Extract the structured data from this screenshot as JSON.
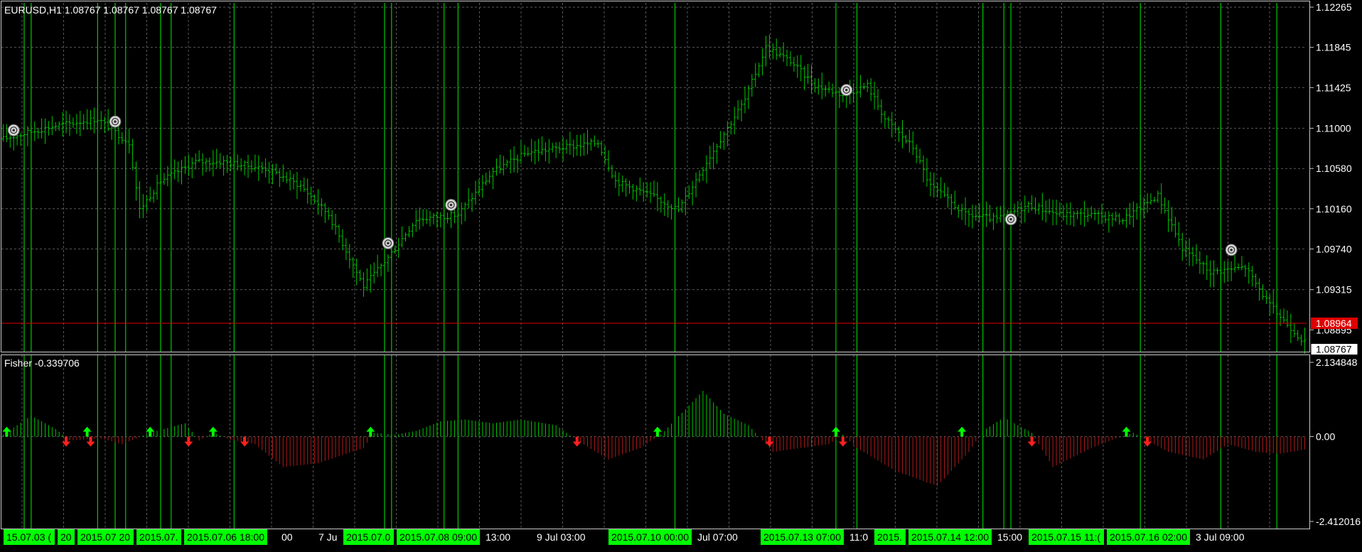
{
  "header": {
    "symbol_line": "EURUSD,H1  1.08767 1.08767 1.08767 1.08767",
    "indicator_line": "Fisher -0.339706"
  },
  "colors": {
    "background": "#000000",
    "frame": "#c8c8c8",
    "grid": "#5a5a5a",
    "bar": "#00c800",
    "signal_line": "#00c800",
    "hist_pos": "#00c800",
    "hist_neg": "#b41a1a",
    "arrow_up": "#00ff00",
    "arrow_down": "#ff2020",
    "red_line": "#e00000",
    "label_text": "#ffffff",
    "time_tag_bg": "#00ff00",
    "time_tag_text": "#000000"
  },
  "price_axis": {
    "ticks": [
      "1.12265",
      "1.11845",
      "1.11425",
      "1.11000",
      "1.10580",
      "1.10160",
      "1.09740",
      "1.09315"
    ],
    "label_partial": "1.08895",
    "red_level_label": "1.08964",
    "current_price_label": "1.08767"
  },
  "indicator_axis": {
    "ticks": [
      "2.134848",
      "0.00",
      "-2.412016"
    ]
  },
  "time_axis": {
    "labels": [
      {
        "text": "15.07.03 (",
        "tag": true
      },
      {
        "text": "20",
        "tag": true
      },
      {
        "text": "2015.07 20",
        "tag": true
      },
      {
        "text": "2015.07.",
        "tag": true
      },
      {
        "text": "2015.07.06 18:00",
        "tag": true
      },
      {
        "text": "00",
        "tag": false
      },
      {
        "text": "7 Ju",
        "tag": false
      },
      {
        "text": "2015.07.0",
        "tag": true
      },
      {
        "text": "2015.07.08 09:00",
        "tag": true
      },
      {
        "text": "13:00",
        "tag": false
      },
      {
        "text": "9 Jul 03:00",
        "tag": false
      },
      {
        "text": "2015.07.10 00:00",
        "tag": true
      },
      {
        "text": "Jul 07:00",
        "tag": false
      },
      {
        "text": "2015.07.13 07:00",
        "tag": true
      },
      {
        "text": "11:0",
        "tag": false
      },
      {
        "text": "2015.",
        "tag": true
      },
      {
        "text": "2015.07.14 12:00",
        "tag": true
      },
      {
        "text": "15:00",
        "tag": false
      },
      {
        "text": "2015.07.15 11:(",
        "tag": true
      },
      {
        "text": "2015.07.16 02:00",
        "tag": true
      },
      {
        "text": "3 Jul 09:00",
        "tag": false
      }
    ]
  },
  "chart_data": [
    {
      "type": "ohlc",
      "symbol": "EURUSD",
      "timeframe": "H1",
      "ylim": [
        1.0866,
        1.1231
      ],
      "close_path": [
        [
          0,
          1.1089
        ],
        [
          14,
          1.1102
        ],
        [
          27,
          1.111
        ],
        [
          36,
          1.1085
        ],
        [
          39,
          1.1015
        ],
        [
          45,
          1.1045
        ],
        [
          55,
          1.1065
        ],
        [
          63,
          1.1065
        ],
        [
          75,
          1.1058
        ],
        [
          85,
          1.104
        ],
        [
          93,
          1.101
        ],
        [
          103,
          1.0935
        ],
        [
          110,
          1.0965
        ],
        [
          118,
          1.1005
        ],
        [
          130,
          1.101
        ],
        [
          140,
          1.1055
        ],
        [
          150,
          1.1075
        ],
        [
          160,
          1.108
        ],
        [
          170,
          1.1085
        ],
        [
          175,
          1.1045
        ],
        [
          185,
          1.103
        ],
        [
          193,
          1.1015
        ],
        [
          201,
          1.1065
        ],
        [
          212,
          1.113
        ],
        [
          218,
          1.1185
        ],
        [
          225,
          1.117
        ],
        [
          232,
          1.1145
        ],
        [
          240,
          1.1135
        ],
        [
          247,
          1.1145
        ],
        [
          252,
          1.111
        ],
        [
          260,
          1.108
        ],
        [
          265,
          1.104
        ],
        [
          275,
          1.101
        ],
        [
          284,
          1.1005
        ],
        [
          293,
          1.102
        ],
        [
          302,
          1.101
        ],
        [
          310,
          1.101
        ],
        [
          320,
          1.1005
        ],
        [
          330,
          1.103
        ],
        [
          337,
          1.0975
        ],
        [
          345,
          1.095
        ],
        [
          355,
          1.0955
        ],
        [
          362,
          1.0915
        ],
        [
          371,
          1.088
        ],
        [
          372,
          1.08767
        ]
      ],
      "current_price": 1.08767,
      "red_level": 1.08964,
      "signal_marks": [
        {
          "bar": 3,
          "price": 1.1098
        },
        {
          "bar": 32,
          "price": 1.1107
        },
        {
          "bar": 110,
          "price": 1.098
        },
        {
          "bar": 128,
          "price": 1.102
        },
        {
          "bar": 241,
          "price": 1.114
        },
        {
          "bar": 288,
          "price": 1.1005
        },
        {
          "bar": 351,
          "price": 1.0973
        }
      ]
    },
    {
      "type": "histogram",
      "name": "Fisher",
      "last_value": -0.339706,
      "ylim": [
        -2.412016,
        2.134848
      ],
      "path": [
        [
          0,
          0.05
        ],
        [
          8,
          0.55
        ],
        [
          15,
          0.2
        ],
        [
          19,
          -0.1
        ],
        [
          28,
          -0.05
        ],
        [
          34,
          -0.2
        ],
        [
          42,
          0.1
        ],
        [
          48,
          0.25
        ],
        [
          52,
          0.35
        ],
        [
          56,
          -0.1
        ],
        [
          60,
          0.1
        ],
        [
          65,
          -0.08
        ],
        [
          72,
          -0.2
        ],
        [
          80,
          -0.8
        ],
        [
          90,
          -0.7
        ],
        [
          103,
          -0.3
        ],
        [
          106,
          0.1
        ],
        [
          112,
          0.05
        ],
        [
          118,
          0.15
        ],
        [
          125,
          0.4
        ],
        [
          132,
          0.45
        ],
        [
          140,
          0.35
        ],
        [
          148,
          0.45
        ],
        [
          158,
          0.3
        ],
        [
          164,
          -0.1
        ],
        [
          173,
          -0.6
        ],
        [
          182,
          -0.3
        ],
        [
          188,
          0.05
        ],
        [
          200,
          1.2
        ],
        [
          206,
          0.6
        ],
        [
          213,
          0.3
        ],
        [
          220,
          -0.4
        ],
        [
          228,
          -0.3
        ],
        [
          236,
          -0.2
        ],
        [
          240,
          0.05
        ],
        [
          244,
          -0.3
        ],
        [
          255,
          -0.9
        ],
        [
          267,
          -1.3
        ],
        [
          276,
          -0.4
        ],
        [
          280,
          0.15
        ],
        [
          286,
          0.5
        ],
        [
          294,
          0.1
        ],
        [
          300,
          -0.8
        ],
        [
          311,
          -0.3
        ],
        [
          318,
          -0.05
        ],
        [
          323,
          0.1
        ],
        [
          327,
          -0.1
        ],
        [
          333,
          -0.4
        ],
        [
          343,
          -0.6
        ],
        [
          350,
          -0.2
        ],
        [
          358,
          -0.4
        ],
        [
          365,
          -0.45
        ],
        [
          372,
          -0.34
        ]
      ],
      "arrows": [
        {
          "bar": 1,
          "dir": "up"
        },
        {
          "bar": 18,
          "dir": "down"
        },
        {
          "bar": 24,
          "dir": "up"
        },
        {
          "bar": 25,
          "dir": "down"
        },
        {
          "bar": 42,
          "dir": "up"
        },
        {
          "bar": 53,
          "dir": "down"
        },
        {
          "bar": 60,
          "dir": "up"
        },
        {
          "bar": 69,
          "dir": "down"
        },
        {
          "bar": 105,
          "dir": "up"
        },
        {
          "bar": 164,
          "dir": "down"
        },
        {
          "bar": 187,
          "dir": "up"
        },
        {
          "bar": 219,
          "dir": "down"
        },
        {
          "bar": 238,
          "dir": "up"
        },
        {
          "bar": 240,
          "dir": "down"
        },
        {
          "bar": 274,
          "dir": "up"
        },
        {
          "bar": 294,
          "dir": "down"
        },
        {
          "bar": 321,
          "dir": "up"
        },
        {
          "bar": 327,
          "dir": "down"
        }
      ]
    }
  ],
  "signal_lines": {
    "bars": [
      6,
      8,
      27,
      32,
      35,
      45,
      48,
      66,
      109,
      111,
      126,
      130,
      192,
      238,
      244,
      280,
      286,
      288,
      325,
      348,
      364
    ]
  }
}
